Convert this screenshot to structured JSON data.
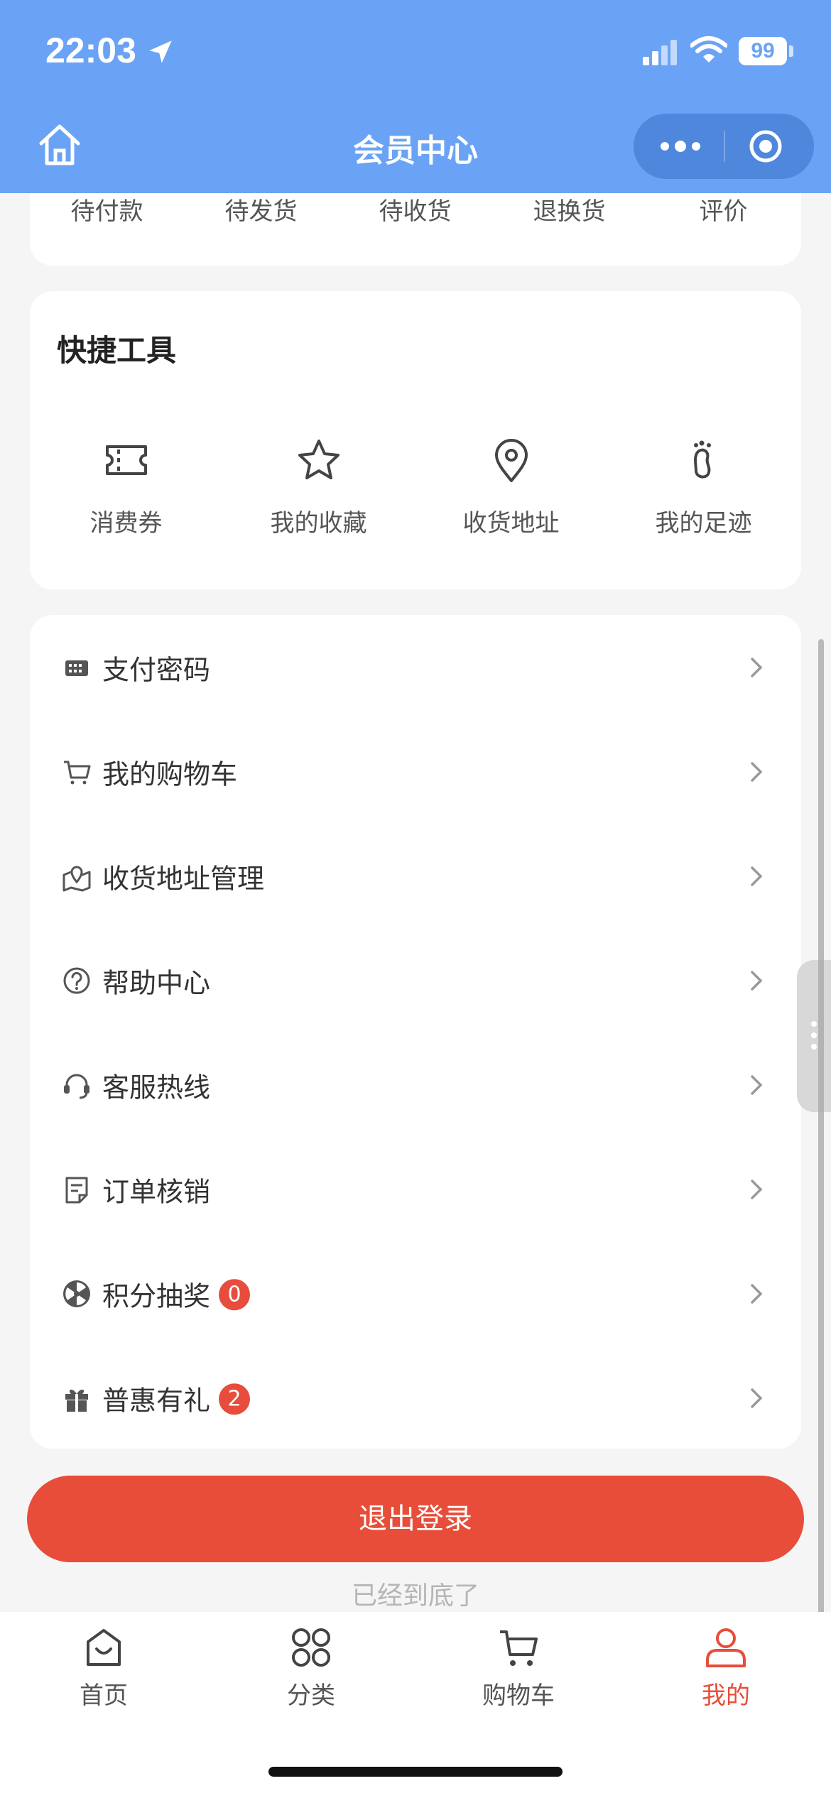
{
  "status_bar": {
    "time": "22:03",
    "battery": "99"
  },
  "nav": {
    "title": "会员中心"
  },
  "orders": {
    "items": [
      "待付款",
      "待发货",
      "待收货",
      "退换货",
      "评价"
    ]
  },
  "tools": {
    "title": "快捷工具",
    "items": [
      {
        "label": "消费券",
        "icon": "ticket-icon"
      },
      {
        "label": "我的收藏",
        "icon": "star-icon"
      },
      {
        "label": "收货地址",
        "icon": "location-pin-icon"
      },
      {
        "label": "我的足迹",
        "icon": "footprint-icon"
      }
    ]
  },
  "menu": {
    "items": [
      {
        "label": "支付密码",
        "icon": "keypad-icon",
        "badge": null
      },
      {
        "label": "我的购物车",
        "icon": "cart-icon",
        "badge": null
      },
      {
        "label": "收货地址管理",
        "icon": "map-pin-icon",
        "badge": null
      },
      {
        "label": "帮助中心",
        "icon": "help-icon",
        "badge": null
      },
      {
        "label": "客服热线",
        "icon": "headset-icon",
        "badge": null
      },
      {
        "label": "订单核销",
        "icon": "document-icon",
        "badge": null
      },
      {
        "label": "积分抽奖",
        "icon": "wheel-icon",
        "badge": "0"
      },
      {
        "label": "普惠有礼",
        "icon": "gift-icon",
        "badge": "2"
      }
    ]
  },
  "logout_label": "退出登录",
  "end_hint": "已经到底了",
  "tabbar": {
    "tabs": [
      {
        "label": "首页",
        "icon": "home-bag-icon",
        "active": false
      },
      {
        "label": "分类",
        "icon": "category-icon",
        "active": false
      },
      {
        "label": "购物车",
        "icon": "cart-icon",
        "active": false
      },
      {
        "label": "我的",
        "icon": "user-icon",
        "active": true
      }
    ]
  },
  "colors": {
    "nav_bg": "#6aa3f5",
    "accent": "#e84d39",
    "badge": "#e74c3c"
  }
}
